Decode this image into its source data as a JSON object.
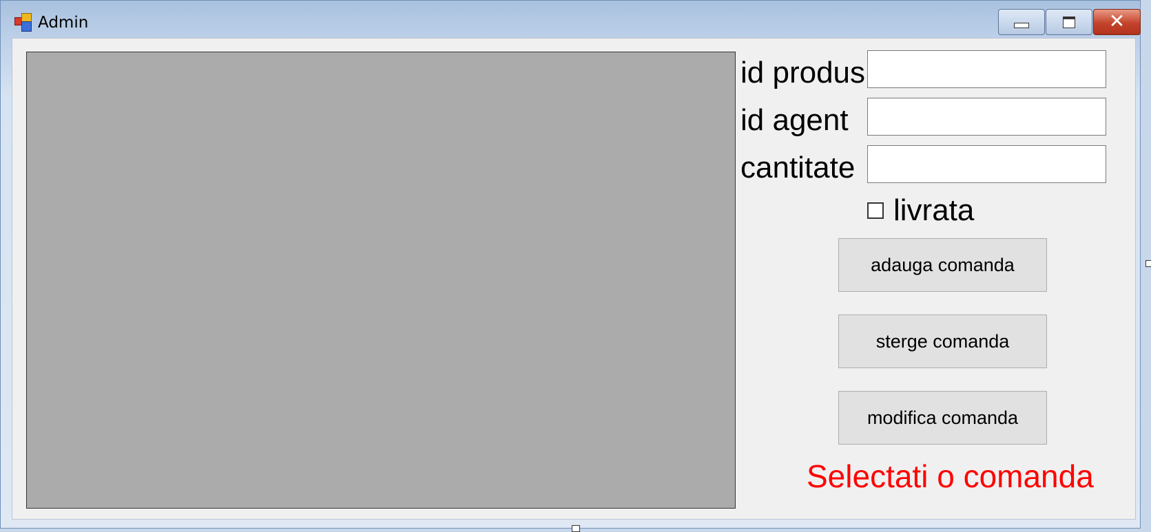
{
  "window": {
    "title": "Admin",
    "icon": "winforms-app-icon",
    "caption_buttons": [
      "minimize-icon",
      "maximize-icon",
      "close-icon"
    ]
  },
  "form": {
    "fields": [
      {
        "label": "id produs",
        "value": ""
      },
      {
        "label": "id agent",
        "value": ""
      },
      {
        "label": "cantitate",
        "value": ""
      }
    ],
    "checkbox": {
      "label": "livrata",
      "checked": false
    },
    "buttons": {
      "add": "adauga comanda",
      "delete": "sterge comanda",
      "modify": "modifica comanda"
    },
    "status": {
      "text": "Selectati o comanda",
      "color": "#ff0000"
    }
  },
  "grid": {
    "rows": [],
    "background": "#ababab"
  }
}
